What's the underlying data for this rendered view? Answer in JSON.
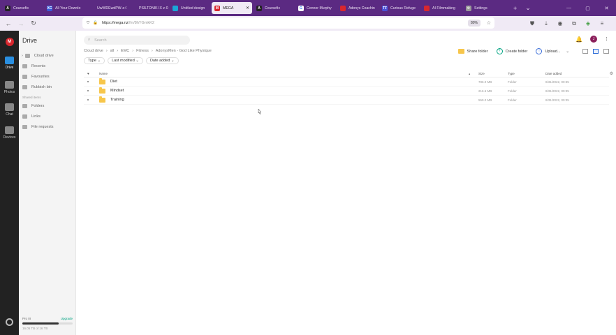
{
  "browser": {
    "tabs": [
      {
        "label": "Coursefix",
        "fav_color": "#222222",
        "fav_glyph": "A"
      },
      {
        "label": "All Your Downlo",
        "fav_color": "#3b5bd9",
        "fav_glyph": "XC"
      },
      {
        "label": "UwWDEwdPW-z-0",
        "fav_color": "#5b2a82",
        "fav_glyph": ""
      },
      {
        "label": "PSILTONIK IX z-0-y",
        "fav_color": "#5b2a82",
        "fav_glyph": ""
      },
      {
        "label": "Untitled design",
        "fav_color": "#1aa6d8",
        "fav_glyph": ""
      },
      {
        "label": "MEGA",
        "fav_color": "#d9272e",
        "fav_glyph": "M",
        "active": true
      },
      {
        "label": "Coursefix",
        "fav_color": "#222222",
        "fav_glyph": "A"
      },
      {
        "label": "Connor Murphy",
        "fav_color": "#ffffff",
        "fav_glyph": "G"
      },
      {
        "label": "Adonys Coachin",
        "fav_color": "#d9272e",
        "fav_glyph": ""
      },
      {
        "label": "Curious Refuge",
        "fav_color": "#4a50d6",
        "fav_glyph": "TF"
      },
      {
        "label": "AI Filmmaking",
        "fav_color": "#d9272e",
        "fav_glyph": ""
      },
      {
        "label": "Settings",
        "fav_color": "#999999",
        "fav_glyph": "⚙"
      }
    ],
    "url_host": "https://mega.nz",
    "url_path": "/fm/8hYGmkK2",
    "zoom": "80%"
  },
  "rail": {
    "items": [
      {
        "label": "Drive",
        "color": "#2a8fe0"
      },
      {
        "label": "Photos",
        "color": "#888888"
      },
      {
        "label": "Chat",
        "color": "#888888"
      },
      {
        "label": "Devices",
        "color": "#888888"
      }
    ]
  },
  "sidebar": {
    "title": "Drive",
    "items": [
      {
        "label": "Cloud drive"
      },
      {
        "label": "Recents"
      },
      {
        "label": "Favourites"
      },
      {
        "label": "Rubbish bin"
      }
    ],
    "shared_heading": "Shared items",
    "shared_items": [
      {
        "label": "Folders"
      },
      {
        "label": "Links"
      },
      {
        "label": "File requests"
      }
    ],
    "storage": {
      "plan": "Pro III",
      "upgrade": "Upgrade",
      "used": "16.05 TB of 16 TB",
      "fraction": 0.72
    }
  },
  "main": {
    "search_placeholder": "Search",
    "user_initial": "J",
    "breadcrumb": [
      "Cloud drive",
      "all",
      "EMC",
      "Fitness",
      "AdonysMen - God Like Physique"
    ],
    "actions": {
      "share": "Share folder",
      "create": "Create folder",
      "upload": "Upload..."
    },
    "filters": [
      "Type",
      "Last modified",
      "Date added"
    ],
    "columns": {
      "name": "Name",
      "size": "Size",
      "type": "Type",
      "date": "Date added"
    },
    "rows": [
      {
        "name": "Diet",
        "size": "786.0 MB",
        "type": "Folder",
        "date": "8/31/2022, 00:35"
      },
      {
        "name": "Mindset",
        "size": "216.6 MB",
        "type": "Folder",
        "date": "8/31/2022, 00:35"
      },
      {
        "name": "Training",
        "size": "559.0 MB",
        "type": "Folder",
        "date": "8/31/2022, 00:35"
      }
    ]
  }
}
